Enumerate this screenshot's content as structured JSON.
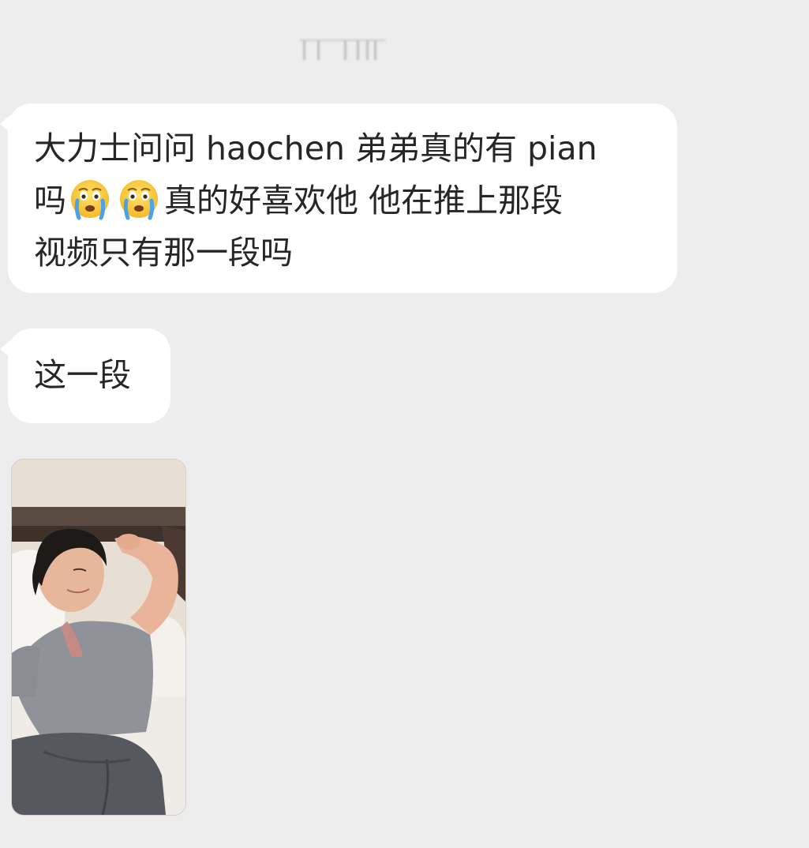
{
  "messages": [
    {
      "lines": [
        "大力士问问 haochen 弟弟真的有 pian",
        "吗",
        "真的好喜欢他 他在推上那段",
        "视频只有那一段吗"
      ],
      "emoji": [
        "loudly-crying-face-emoji",
        "loudly-crying-face-emoji"
      ]
    },
    {
      "text": "这一段"
    }
  ],
  "image_message": {
    "description_icon": "photo-thumbnail"
  },
  "colors": {
    "background": "#ededed",
    "bubble": "#ffffff",
    "text": "#262626"
  }
}
